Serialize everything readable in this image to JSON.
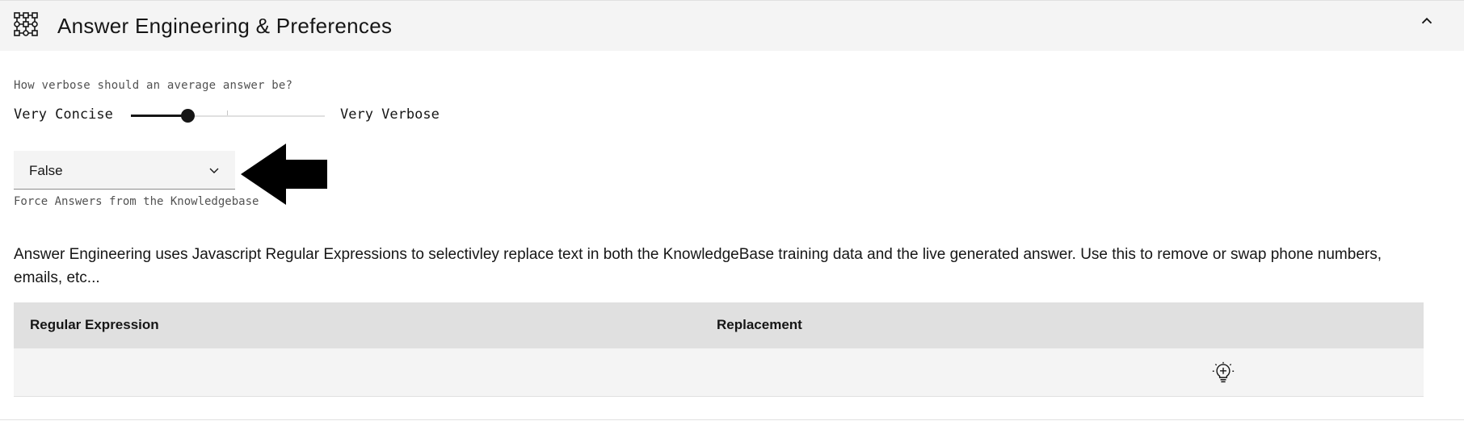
{
  "accordion": {
    "title": "Answer Engineering & Preferences",
    "icon": "workflow-icon",
    "toggle_icon": "chevron-up-icon"
  },
  "verbosity": {
    "label": "How verbose should an average answer be?",
    "min_label": "Very Concise",
    "max_label": "Very Verbose",
    "value_fraction": 0.29
  },
  "force_answers": {
    "selected": "False",
    "helper": "Force Answers from the Knowledgebase",
    "icon": "chevron-down-icon"
  },
  "description": "Answer Engineering uses Javascript Regular Expressions to selectivley replace text in both the KnowledgeBase training data and the live generated answer. Use this to remove or swap phone numbers, emails, etc...",
  "table": {
    "columns": [
      "Regular Expression",
      "Replacement"
    ],
    "rows": [
      {
        "regex": "",
        "replacement": "",
        "action_icon": "idea-add-icon"
      }
    ]
  },
  "colors": {
    "header_bg": "#f4f4f4",
    "table_header_bg": "#e0e0e0",
    "text": "#161616",
    "helper_text": "#525252"
  }
}
